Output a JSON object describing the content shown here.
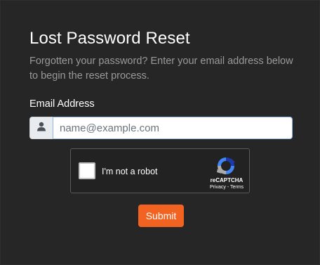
{
  "page": {
    "title": "Lost Password Reset",
    "description": "Forgotten your password? Enter your email address below to begin the reset process."
  },
  "form": {
    "email_label": "Email Address",
    "email_value": "",
    "email_placeholder": "name@example.com",
    "email_icon": "user-icon",
    "submit_label": "Submit"
  },
  "recaptcha": {
    "label": "I'm not a robot",
    "checked": false,
    "brand": "reCAPTCHA",
    "privacy": "Privacy",
    "separator": " - ",
    "terms": "Terms"
  },
  "colors": {
    "background": "#262626",
    "accent": "#f26322",
    "muted_text": "#9a9a9a"
  }
}
